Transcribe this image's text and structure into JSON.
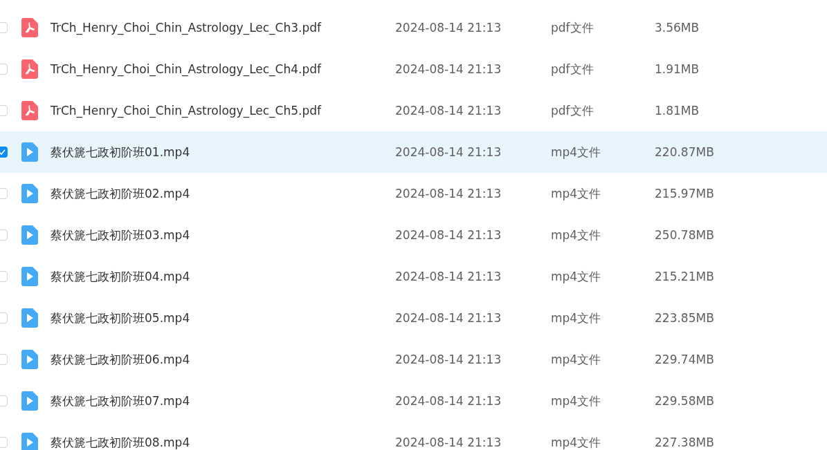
{
  "files": [
    {
      "name": "TrCh_Henry_Choi_Chin_Astrology_Lec_Ch3.pdf",
      "kind": "pdf",
      "modified": "2024-08-14 21:13",
      "type": "pdf文件",
      "size": "3.56MB",
      "selected": false
    },
    {
      "name": "TrCh_Henry_Choi_Chin_Astrology_Lec_Ch4.pdf",
      "kind": "pdf",
      "modified": "2024-08-14 21:13",
      "type": "pdf文件",
      "size": "1.91MB",
      "selected": false
    },
    {
      "name": "TrCh_Henry_Choi_Chin_Astrology_Lec_Ch5.pdf",
      "kind": "pdf",
      "modified": "2024-08-14 21:13",
      "type": "pdf文件",
      "size": "1.81MB",
      "selected": false
    },
    {
      "name": "蔡伏篪七政初阶班01.mp4",
      "kind": "video",
      "modified": "2024-08-14 21:13",
      "type": "mp4文件",
      "size": "220.87MB",
      "selected": true
    },
    {
      "name": "蔡伏篪七政初阶班02.mp4",
      "kind": "video",
      "modified": "2024-08-14 21:13",
      "type": "mp4文件",
      "size": "215.97MB",
      "selected": false
    },
    {
      "name": "蔡伏篪七政初阶班03.mp4",
      "kind": "video",
      "modified": "2024-08-14 21:13",
      "type": "mp4文件",
      "size": "250.78MB",
      "selected": false
    },
    {
      "name": "蔡伏篪七政初阶班04.mp4",
      "kind": "video",
      "modified": "2024-08-14 21:13",
      "type": "mp4文件",
      "size": "215.21MB",
      "selected": false
    },
    {
      "name": "蔡伏篪七政初阶班05.mp4",
      "kind": "video",
      "modified": "2024-08-14 21:13",
      "type": "mp4文件",
      "size": "223.85MB",
      "selected": false
    },
    {
      "name": "蔡伏篪七政初阶班06.mp4",
      "kind": "video",
      "modified": "2024-08-14 21:13",
      "type": "mp4文件",
      "size": "229.74MB",
      "selected": false
    },
    {
      "name": "蔡伏篪七政初阶班07.mp4",
      "kind": "video",
      "modified": "2024-08-14 21:13",
      "type": "mp4文件",
      "size": "229.58MB",
      "selected": false
    },
    {
      "name": "蔡伏篪七政初阶班08.mp4",
      "kind": "video",
      "modified": "2024-08-14 21:13",
      "type": "mp4文件",
      "size": "227.38MB",
      "selected": false
    }
  ]
}
